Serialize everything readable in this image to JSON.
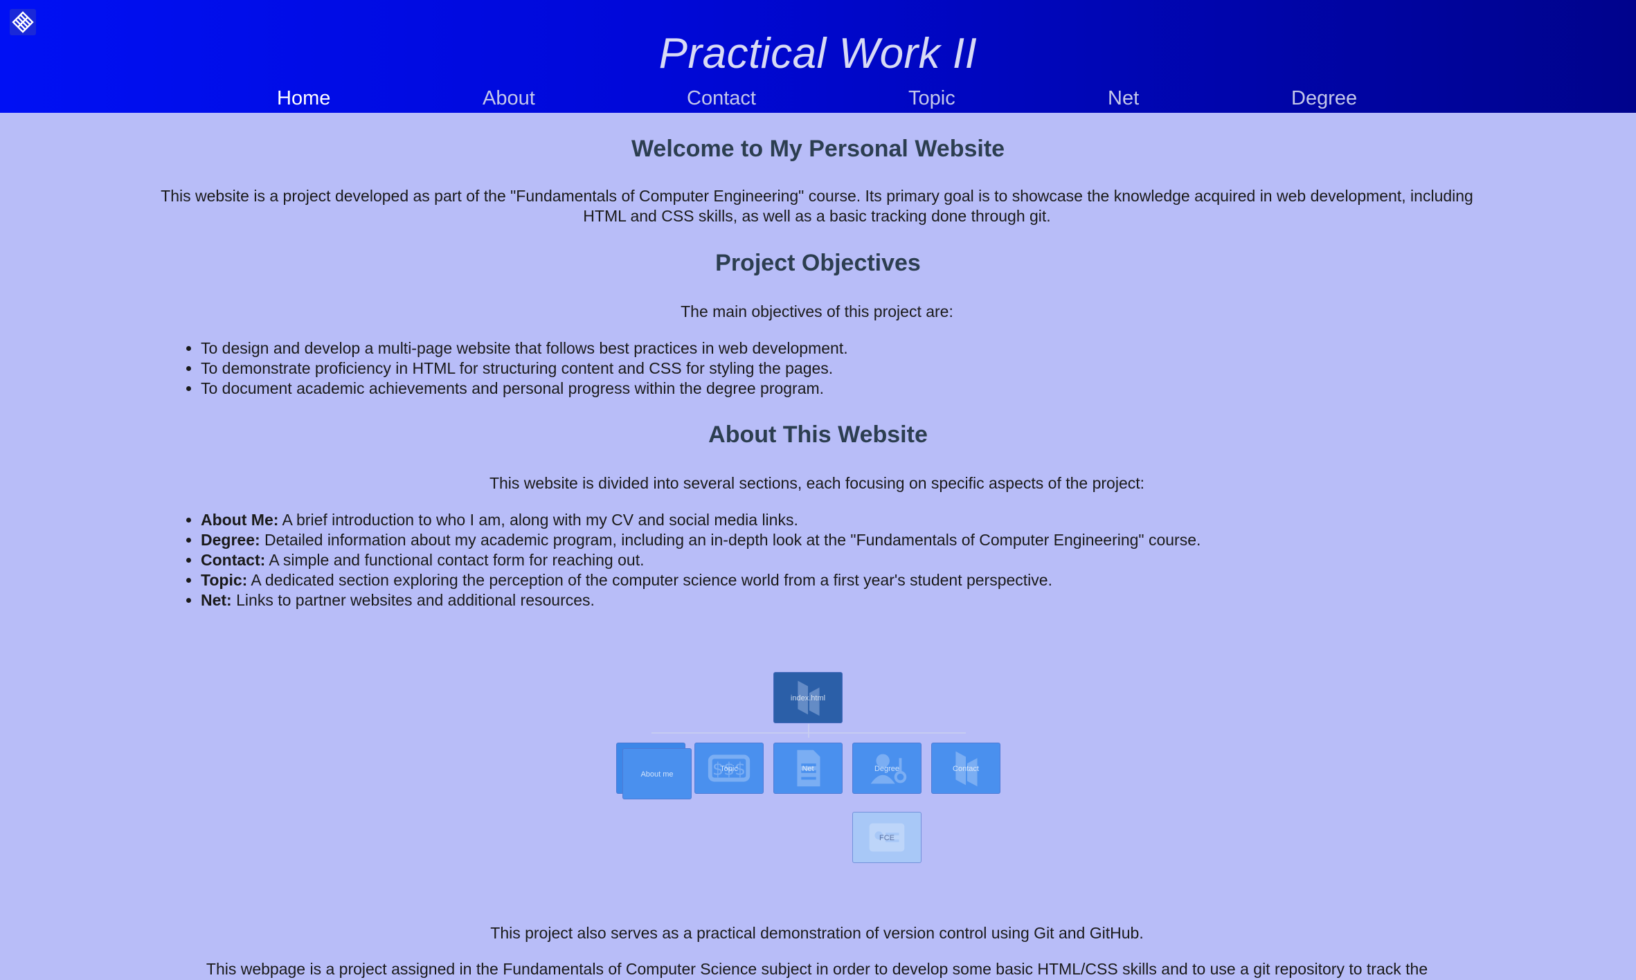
{
  "header": {
    "title": "Practical Work II",
    "logo_icon": "grid-diamond-icon",
    "nav": [
      {
        "label": "Home",
        "active": true
      },
      {
        "label": "About",
        "active": false
      },
      {
        "label": "Contact",
        "active": false
      },
      {
        "label": "Topic",
        "active": false
      },
      {
        "label": "Net",
        "active": false
      },
      {
        "label": "Degree",
        "active": false
      }
    ]
  },
  "welcome": {
    "heading": "Welcome to My Personal Website",
    "text": "This website is a project developed as part of the \"Fundamentals of Computer Engineering\" course. Its primary goal is to showcase the knowledge acquired in web development, including HTML and CSS skills, as well as a basic tracking done through git."
  },
  "objectives": {
    "heading": "Project Objectives",
    "intro": "The main objectives of this project are:",
    "items": [
      "To design and develop a multi-page website that follows best practices in web development.",
      "To demonstrate proficiency in HTML for structuring content and CSS for styling the pages.",
      "To document academic achievements and personal progress within the degree program."
    ]
  },
  "about": {
    "heading": "About This Website",
    "intro": "This website is divided into several sections, each focusing on specific aspects of the project:",
    "items": [
      {
        "term": "About Me:",
        "desc": " A brief introduction to who I am, along with my CV and social media links."
      },
      {
        "term": "Degree:",
        "desc": " Detailed information about my academic program, including an in-depth look at the \"Fundamentals of Computer Engineering\" course."
      },
      {
        "term": "Contact:",
        "desc": " A simple and functional contact form for reaching out."
      },
      {
        "term": "Topic:",
        "desc": " A dedicated section exploring the perception of the computer science world from a first year's student perspective."
      },
      {
        "term": "Net:",
        "desc": " Links to partner websites and additional resources."
      }
    ]
  },
  "sitemap": {
    "root": "index.html",
    "children": [
      "About me",
      "Topic",
      "Net",
      "Degree",
      "Contact"
    ],
    "grandchild": "FCE"
  },
  "footer": {
    "vc_text": "This project also serves as a practical demonstration of version control using Git and GitHub.",
    "note_text": "This webpage is a project assigned in the Fundamentals of Computer Science subject in order to develop some basic HTML/CSS skills and to use a git repository to track the"
  },
  "colors": {
    "header_start": "#0010f4",
    "header_end": "#00038c",
    "page_bg": "#b8bdf8",
    "heading": "#2c3e50"
  }
}
